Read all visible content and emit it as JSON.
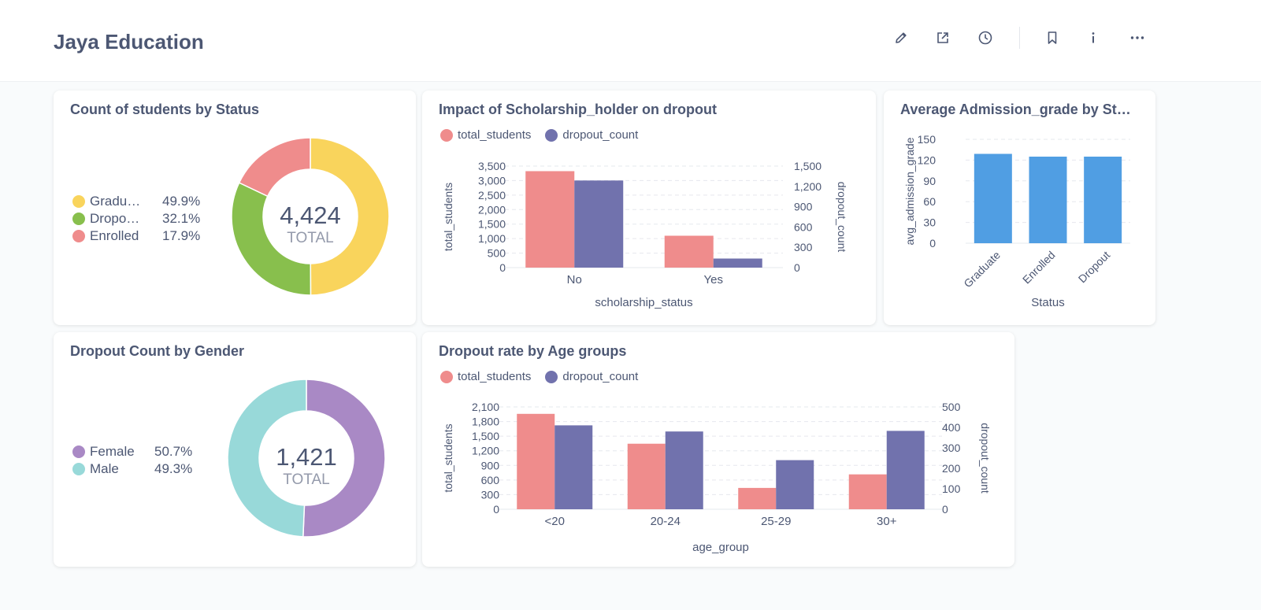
{
  "header": {
    "title": "Jaya Education",
    "icons": [
      "pencil-icon",
      "share-icon",
      "clock-icon",
      "bookmark-icon",
      "info-icon",
      "more-icon"
    ]
  },
  "colors": {
    "graduate": "#f9d45c",
    "dropout_green": "#88bf4d",
    "enrolled": "#ef8c8c",
    "female": "#a989c5",
    "male": "#98d9d9",
    "total_students": "#ef8c8c",
    "dropout_count": "#7172ad",
    "bar_blue": "#509ee3",
    "text": "#4c5773"
  },
  "cards": {
    "status": {
      "title": "Count of students by Status",
      "total": "4,424",
      "total_label": "TOTAL",
      "legend": [
        {
          "name": "Graduate",
          "display": "Gradu…",
          "pct": "49.9%"
        },
        {
          "name": "Dropout",
          "display": "Dropo…",
          "pct": "32.1%"
        },
        {
          "name": "Enrolled",
          "display": "Enrolled",
          "pct": "17.9%"
        }
      ]
    },
    "scholarship": {
      "title": "Impact of Scholarship_holder on dropout",
      "legend": [
        "total_students",
        "dropout_count"
      ]
    },
    "admission": {
      "title": "Average Admission_grade by St…"
    },
    "gender": {
      "title": "Dropout Count by Gender",
      "total": "1,421",
      "total_label": "TOTAL",
      "legend": [
        {
          "name": "Female",
          "pct": "50.7%"
        },
        {
          "name": "Male",
          "pct": "49.3%"
        }
      ]
    },
    "age": {
      "title": "Dropout rate by Age groups",
      "legend": [
        "total_students",
        "dropout_count"
      ]
    }
  },
  "chart_data": [
    {
      "type": "pie",
      "title": "Count of students by Status",
      "categories": [
        "Graduate",
        "Dropout",
        "Enrolled"
      ],
      "values": [
        2209,
        1421,
        794
      ],
      "percentages": [
        49.9,
        32.1,
        17.9
      ],
      "total": 4424
    },
    {
      "type": "bar",
      "title": "Impact of Scholarship_holder on dropout",
      "categories": [
        "No",
        "Yes"
      ],
      "xlabel": "scholarship_status",
      "ylabel": "total_students",
      "y2label": "dropout_count",
      "ylim": [
        0,
        3500
      ],
      "y2lim": [
        0,
        1500
      ],
      "yticks": [
        0,
        500,
        1000,
        1500,
        2000,
        2500,
        3000,
        3500
      ],
      "y2ticks": [
        0,
        300,
        600,
        900,
        1200,
        1500
      ],
      "series": [
        {
          "name": "total_students",
          "axis": "left",
          "values": [
            3325,
            1099
          ]
        },
        {
          "name": "dropout_count",
          "axis": "right",
          "values": [
            1287,
            134
          ]
        }
      ],
      "grid": true,
      "legend": "top-left"
    },
    {
      "type": "bar",
      "title": "Average Admission_grade by St…",
      "categories": [
        "Graduate",
        "Enrolled",
        "Dropout"
      ],
      "values": [
        129,
        125,
        125
      ],
      "xlabel": "Status",
      "ylabel": "avg_admission_grade",
      "ylim": [
        0,
        150
      ],
      "yticks": [
        0,
        30,
        60,
        90,
        120,
        150
      ],
      "grid": true
    },
    {
      "type": "pie",
      "title": "Dropout Count by Gender",
      "categories": [
        "Female",
        "Male"
      ],
      "values": [
        720,
        701
      ],
      "percentages": [
        50.7,
        49.3
      ],
      "total": 1421
    },
    {
      "type": "bar",
      "title": "Dropout rate by Age groups",
      "categories": [
        "<20",
        "20-24",
        "25-29",
        "30+"
      ],
      "xlabel": "age_group",
      "ylabel": "total_students",
      "y2label": "dropout_count",
      "ylim": [
        0,
        2100
      ],
      "y2lim": [
        0,
        500
      ],
      "yticks": [
        0,
        300,
        600,
        900,
        1200,
        1500,
        1800,
        2100
      ],
      "y2ticks": [
        0,
        100,
        200,
        300,
        400,
        500
      ],
      "series": [
        {
          "name": "total_students",
          "axis": "left",
          "values": [
            1958,
            1345,
            438,
            716
          ]
        },
        {
          "name": "dropout_count",
          "axis": "right",
          "values": [
            410,
            380,
            240,
            383
          ]
        }
      ],
      "grid": true,
      "legend": "top-left"
    }
  ]
}
